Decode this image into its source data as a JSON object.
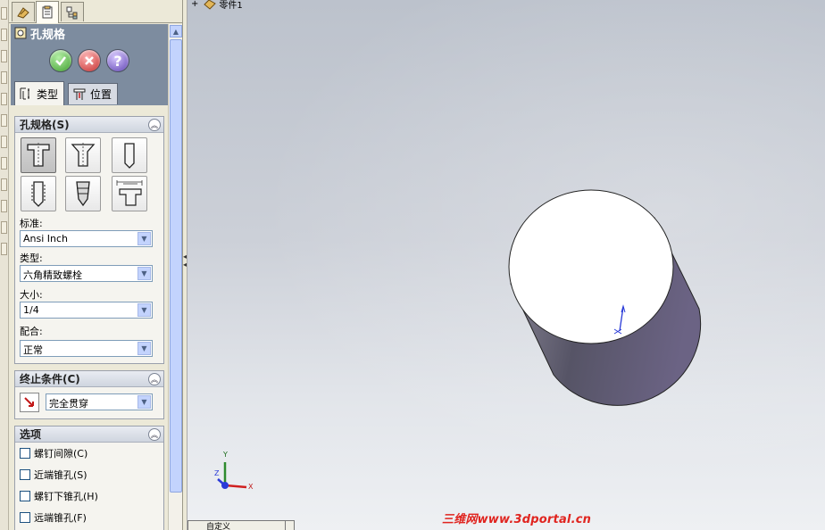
{
  "tree": {
    "part_name": "零件1",
    "expand_symbol": "+"
  },
  "property_manager": {
    "title": "孔规格",
    "tabs": [
      {
        "label": "类型"
      },
      {
        "label": "位置"
      }
    ],
    "buttons": {
      "help_symbol": "?"
    }
  },
  "hole_spec_group": {
    "title": "孔规格(S)",
    "hole_types": [
      {
        "icon": "counterbore-icon"
      },
      {
        "icon": "countersink-icon"
      },
      {
        "icon": "simple-hole-icon"
      },
      {
        "icon": "tapped-hole-icon"
      },
      {
        "icon": "pipe-tap-icon"
      },
      {
        "icon": "legacy-hole-icon"
      }
    ],
    "selected_index": 0,
    "standard_label": "标准:",
    "standard_value": "Ansi Inch",
    "type_label": "类型:",
    "type_value": "六角精致螺栓",
    "size_label": "大小:",
    "size_value": "1/4",
    "fit_label": "配合:",
    "fit_value": "正常"
  },
  "end_condition_group": {
    "title": "终止条件(C)",
    "value": "完全贯穿"
  },
  "options_group": {
    "title": "选项",
    "options": [
      {
        "label": "螺钉间隙(C)",
        "checked": false
      },
      {
        "label": "近端锥孔(S)",
        "checked": false
      },
      {
        "label": "螺钉下锥孔(H)",
        "checked": false
      },
      {
        "label": "远端锥孔(F)",
        "checked": false
      }
    ]
  },
  "viewport": {
    "triad_labels": {
      "x": "X",
      "y": "Y",
      "z": "Z"
    },
    "bottom_tab_label": "自定义"
  },
  "watermark": {
    "text": "三维网www.3dportal.cn"
  },
  "colors": {
    "header_bg": "#7d8c9f",
    "watermark": "#e0241f",
    "cylinder_side": "#615c73"
  }
}
